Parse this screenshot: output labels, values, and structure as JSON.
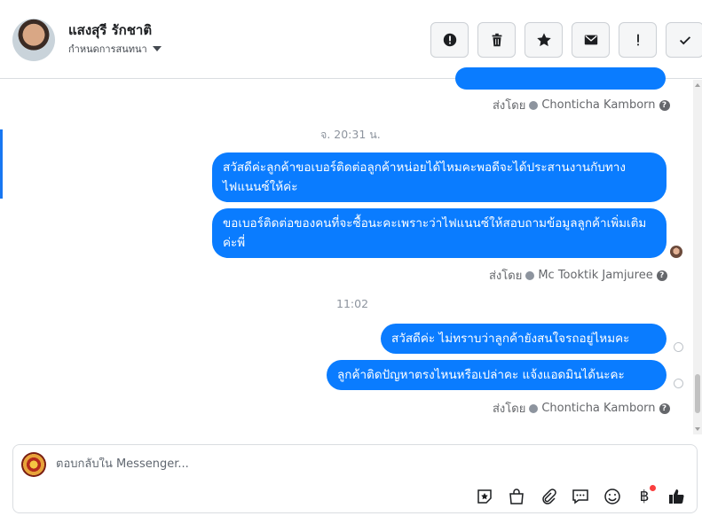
{
  "header": {
    "name": "แสงสุรี รักชาติ",
    "subtitle": "กำหนดการสนทนา",
    "actions": [
      {
        "icon": "alert-icon"
      },
      {
        "icon": "trash-icon"
      },
      {
        "icon": "star-icon"
      },
      {
        "icon": "mail-icon"
      },
      {
        "icon": "exclamation-icon",
        "text": "!"
      },
      {
        "icon": "check-icon"
      }
    ]
  },
  "thread": {
    "sent_by_1": {
      "prefix": "ส่งโดย",
      "name": "Chonticha Kamborn"
    },
    "timestamp_1": "จ. 20:31 น.",
    "messages_1": [
      "สวัสดีค่ะลูกค้าขอเบอร์ติดต่อลูกค้าหน่อยได้ไหมคะพอดีจะได้ประสานงานกับทางไฟแนนซ์ให้ค่ะ",
      "ขอเบอร์ติดต่อของคนที่จะซื้อนะคะเพราะว่าไฟแนนซ์ให้สอบถามข้อมูลลูกค้าเพิ่มเติมค่ะพี่"
    ],
    "sent_by_2": {
      "prefix": "ส่งโดย",
      "name": "Mc Tooktik Jamjuree"
    },
    "timestamp_2": "11:02",
    "messages_2": [
      "สวัสดีค่ะ ไม่ทราบว่าลูกค้ายังสนใจรถอยู่ไหมคะ",
      "ลูกค้าติดปัญหาตรงไหนหรือเปล่าคะ แจ้งแอดมินได้นะคะ"
    ],
    "sent_by_3": {
      "prefix": "ส่งโดย",
      "name": "Chonticha Kamborn"
    }
  },
  "composer": {
    "placeholder": "ตอบกลับใน Messenger...",
    "tools": [
      "sticker-icon",
      "shop-bag-icon",
      "attachment-icon",
      "saved-reply-icon",
      "emoji-icon",
      "baht-icon",
      "like-icon"
    ],
    "baht_symbol": "฿"
  },
  "colors": {
    "bubble": "#0a7cff",
    "accent": "#1877f2",
    "notification_dot": "#fa3e3e"
  }
}
